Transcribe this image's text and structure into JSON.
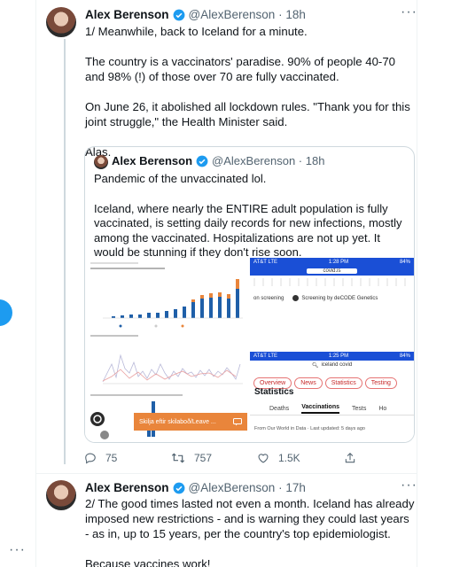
{
  "side": {
    "more_label": "···"
  },
  "tweet1": {
    "name": "Alex Berenson",
    "handle": "@AlexBerenson",
    "time": "18h",
    "paragraphs": [
      "1/ Meanwhile, back to Iceland for a minute.",
      "The country is a vaccinators' paradise. 90% of people 40-70 and 98% (!) of those over 70 are fully vaccinated.",
      "On June 26, it abolished all lockdown rules. \"Thank you for this joint struggle,\" the Health Minister said.",
      "Alas."
    ]
  },
  "quote": {
    "name": "Alex Berenson",
    "handle": "@AlexBerenson",
    "time": "18h",
    "paragraphs": [
      "Pandemic of the unvaccinated lol.",
      "Iceland, where nearly the ENTIRE adult population is fully vaccinated, is setting daily records for new infections, mostly among the vaccinated. Hospitalizations are not up yet. It would be stunning if they don't rise soon."
    ],
    "media": {
      "phone1": {
        "carrier": "AT&T LTE",
        "time": "1:28 PM",
        "battery": "84%",
        "url": "covid.is",
        "legend1": "on screening",
        "legend2": "Screening by deCODE Genetics"
      },
      "phone2": {
        "carrier": "AT&T LTE",
        "time": "1:25 PM",
        "battery": "84%",
        "search": "iceland covid",
        "chips": [
          "Overview",
          "News",
          "Statistics",
          "Testing"
        ],
        "heading": "Statistics",
        "tabs": [
          "Deaths",
          "Vaccinations",
          "Tests",
          "Ho"
        ],
        "source": "From Our World in Data · Last updated: 5 days ago"
      },
      "toast": "Skilja eftir skilaboð/Leave ..."
    }
  },
  "actions": {
    "replies": "75",
    "retweets": "757",
    "likes": "1.5K"
  },
  "tweet2": {
    "name": "Alex Berenson",
    "handle": "@AlexBerenson",
    "time": "17h",
    "paragraphs": [
      "2/ The good times lasted not even a month. Iceland has already imposed new restrictions - and is warning they could last years - as in, up to 15 years, per the country's top epidemiologist.",
      "Because vaccines work!"
    ]
  },
  "colors": {
    "accent": "#1d9bf0",
    "muted": "#536471",
    "toast": "#e9853b"
  }
}
